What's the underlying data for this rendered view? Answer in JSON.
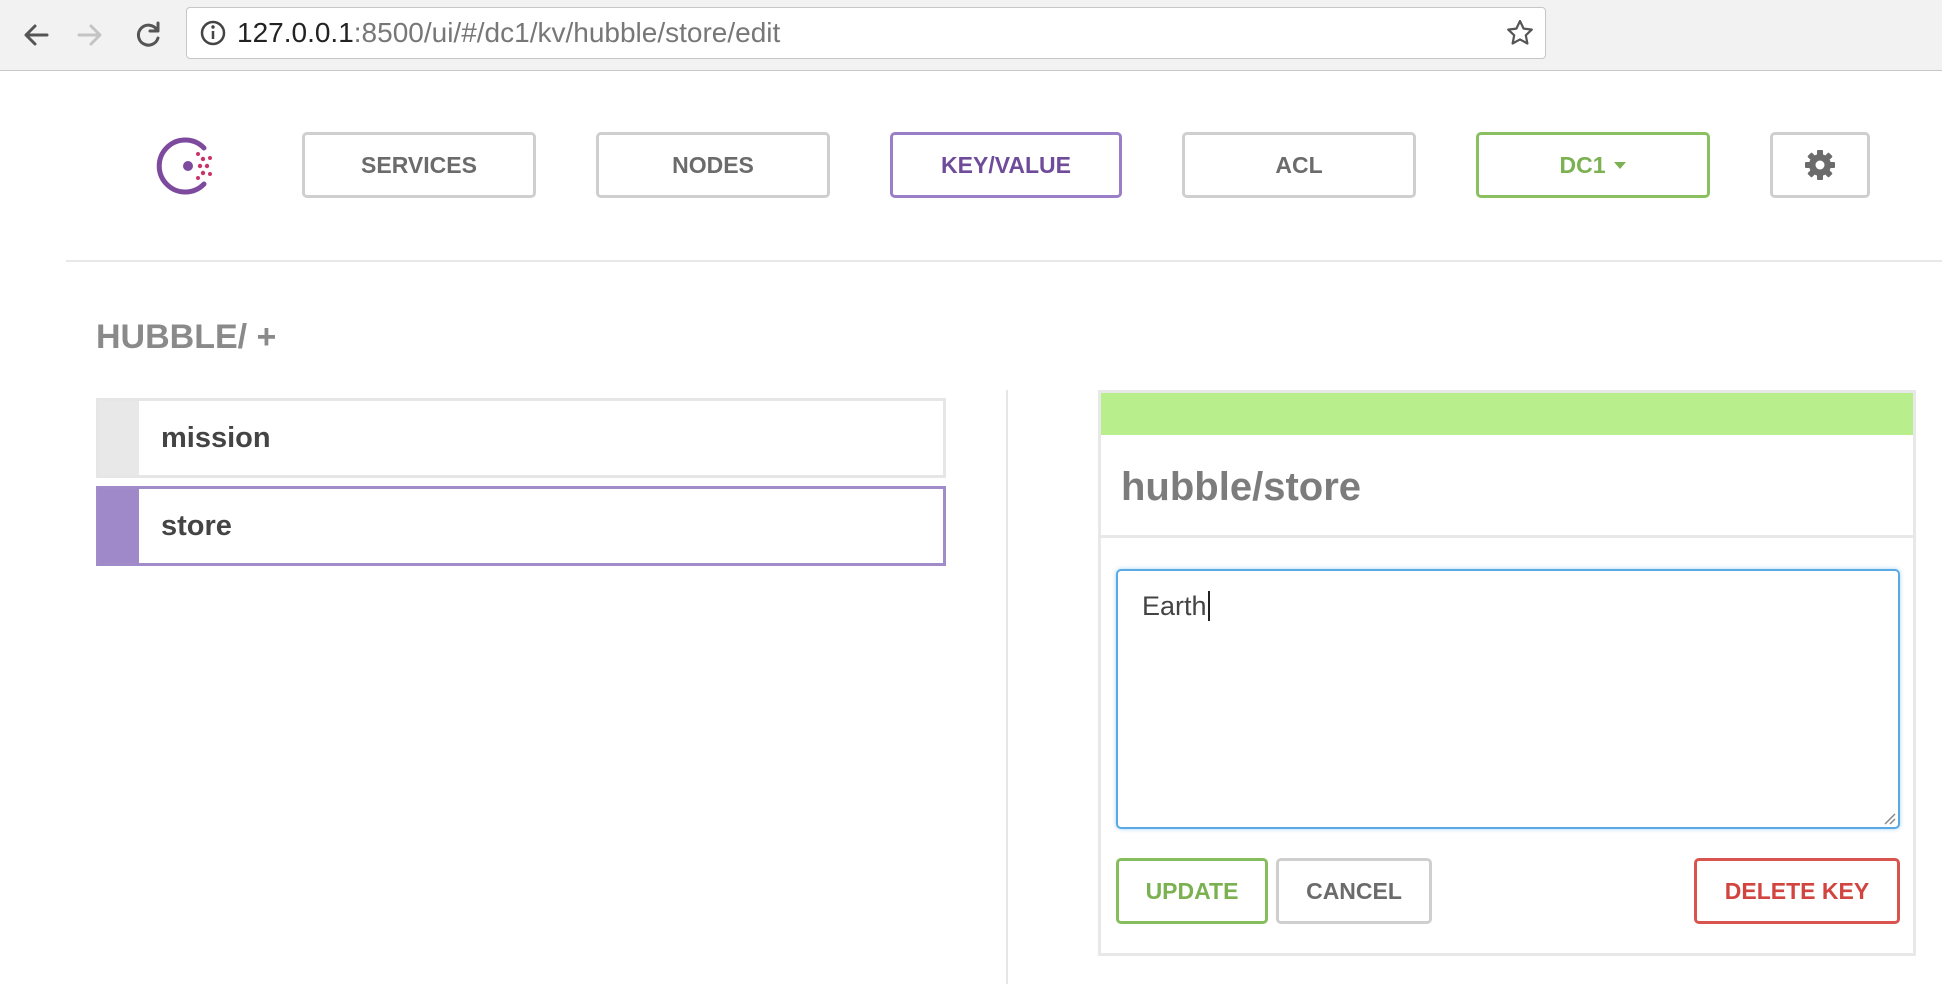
{
  "browser": {
    "url_host": "127.0.0.1",
    "url_rest": ":8500/ui/#/dc1/kv/hubble/store/edit"
  },
  "header": {
    "nav": [
      {
        "label": "SERVICES"
      },
      {
        "label": "NODES"
      },
      {
        "label": "KEY/VALUE",
        "active": true
      },
      {
        "label": "ACL"
      }
    ],
    "datacenter": "DC1"
  },
  "kv": {
    "path_title": "HUBBLE/ +",
    "items": [
      {
        "label": "mission",
        "selected": false
      },
      {
        "label": "store",
        "selected": true
      }
    ]
  },
  "editor": {
    "key_title": "hubble/store",
    "value": "Earth",
    "update_label": "UPDATE",
    "cancel_label": "CANCEL",
    "delete_label": "DELETE KEY"
  },
  "colors": {
    "accent_purple": "#9b7ec8",
    "green": "#86bd5d",
    "panel_header_green": "#b9ee8d",
    "delete_red": "#d9534f",
    "focus_blue": "#59a9e5"
  }
}
